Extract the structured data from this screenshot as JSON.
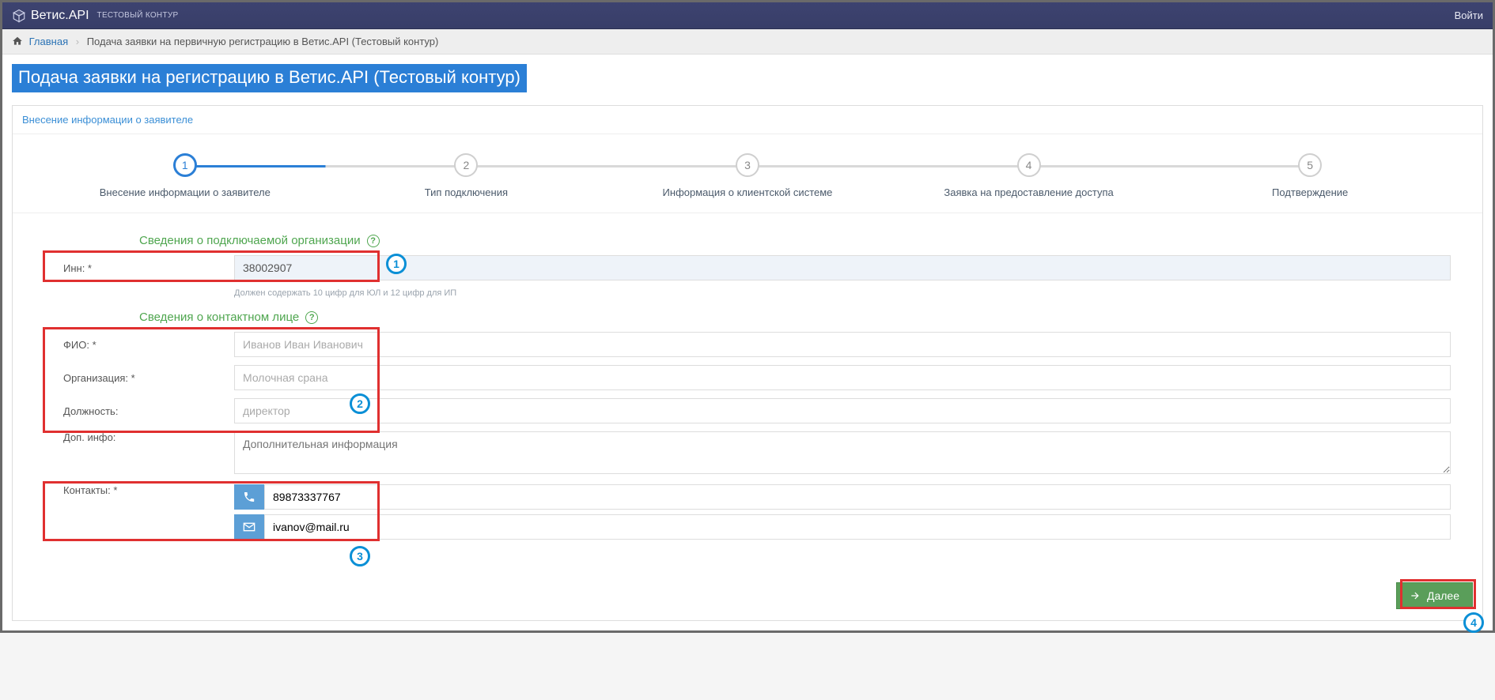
{
  "header": {
    "brand": "Ветис.API",
    "env": "ТЕСТОВЫЙ КОНТУР",
    "login": "Войти"
  },
  "breadcrumb": {
    "home": "Главная",
    "current": "Подача заявки на первичную регистрацию в Ветис.API (Тестовый контур)"
  },
  "page_title": "Подача заявки на регистрацию в Ветис.API (Тестовый контур)",
  "panel_header": "Внесение информации о заявителе",
  "steps": [
    {
      "num": "1",
      "label": "Внесение информации о заявителе"
    },
    {
      "num": "2",
      "label": "Тип подключения"
    },
    {
      "num": "3",
      "label": "Информация о клиентской системе"
    },
    {
      "num": "4",
      "label": "Заявка на предоставление доступа"
    },
    {
      "num": "5",
      "label": "Подтверждение"
    }
  ],
  "sections": {
    "org_title": "Сведения о подключаемой организации",
    "contact_title": "Сведения о контактном лице"
  },
  "fields": {
    "inn_label": "Инн: *",
    "inn_value": "38002907",
    "inn_hint": "Должен содержать 10 цифр для ЮЛ и 12 цифр для ИП",
    "fio_label": "ФИО: *",
    "fio_placeholder": "Иванов Иван Иванович",
    "org_label": "Организация: *",
    "org_placeholder": "Молочная срана",
    "position_label": "Должность:",
    "position_placeholder": "директор",
    "extra_label": "Доп. инфо:",
    "extra_placeholder": "Дополнительная информация",
    "contacts_label": "Контакты: *",
    "phone_value": "89873337767",
    "email_value": "ivanov@mail.ru"
  },
  "actions": {
    "next": "Далее"
  },
  "annotations": {
    "n1": "1",
    "n2": "2",
    "n3": "3",
    "n4": "4"
  }
}
